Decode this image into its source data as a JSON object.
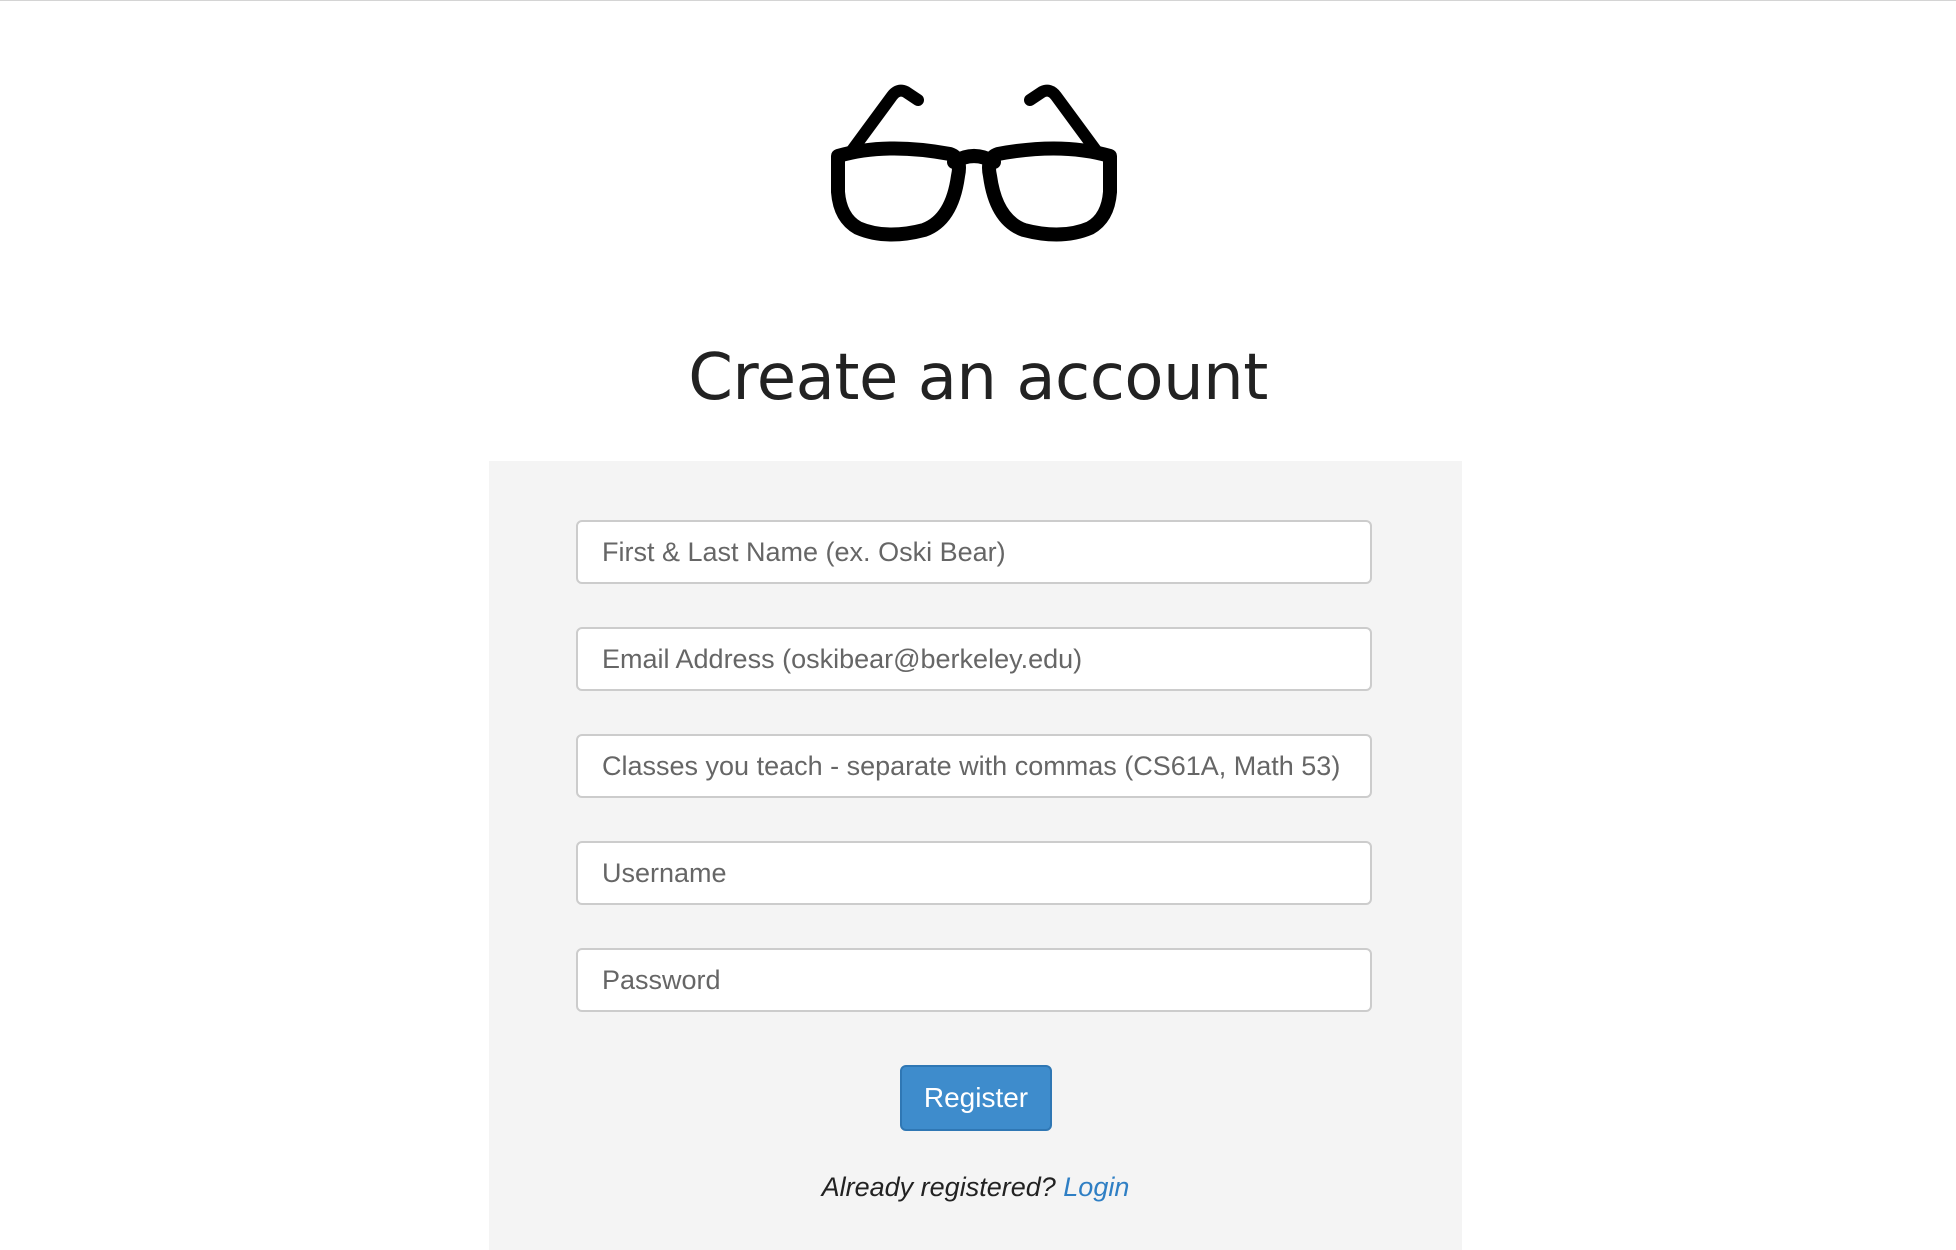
{
  "page": {
    "title": "Create an account"
  },
  "logo": {
    "icon": "glasses-icon"
  },
  "form": {
    "name_placeholder": "First & Last Name (ex. Oski Bear)",
    "email_placeholder": "Email Address (oskibear@berkeley.edu)",
    "classes_placeholder": "Classes you teach - separate with commas (CS61A, Math 53)",
    "username_placeholder": "Username",
    "password_placeholder": "Password",
    "register_label": "Register",
    "already_registered_text": "Already registered?",
    "login_link_label": "Login"
  },
  "colors": {
    "primary_button": "#3e8ccc",
    "link": "#2f7fc4",
    "panel_background": "#f4f4f4"
  }
}
